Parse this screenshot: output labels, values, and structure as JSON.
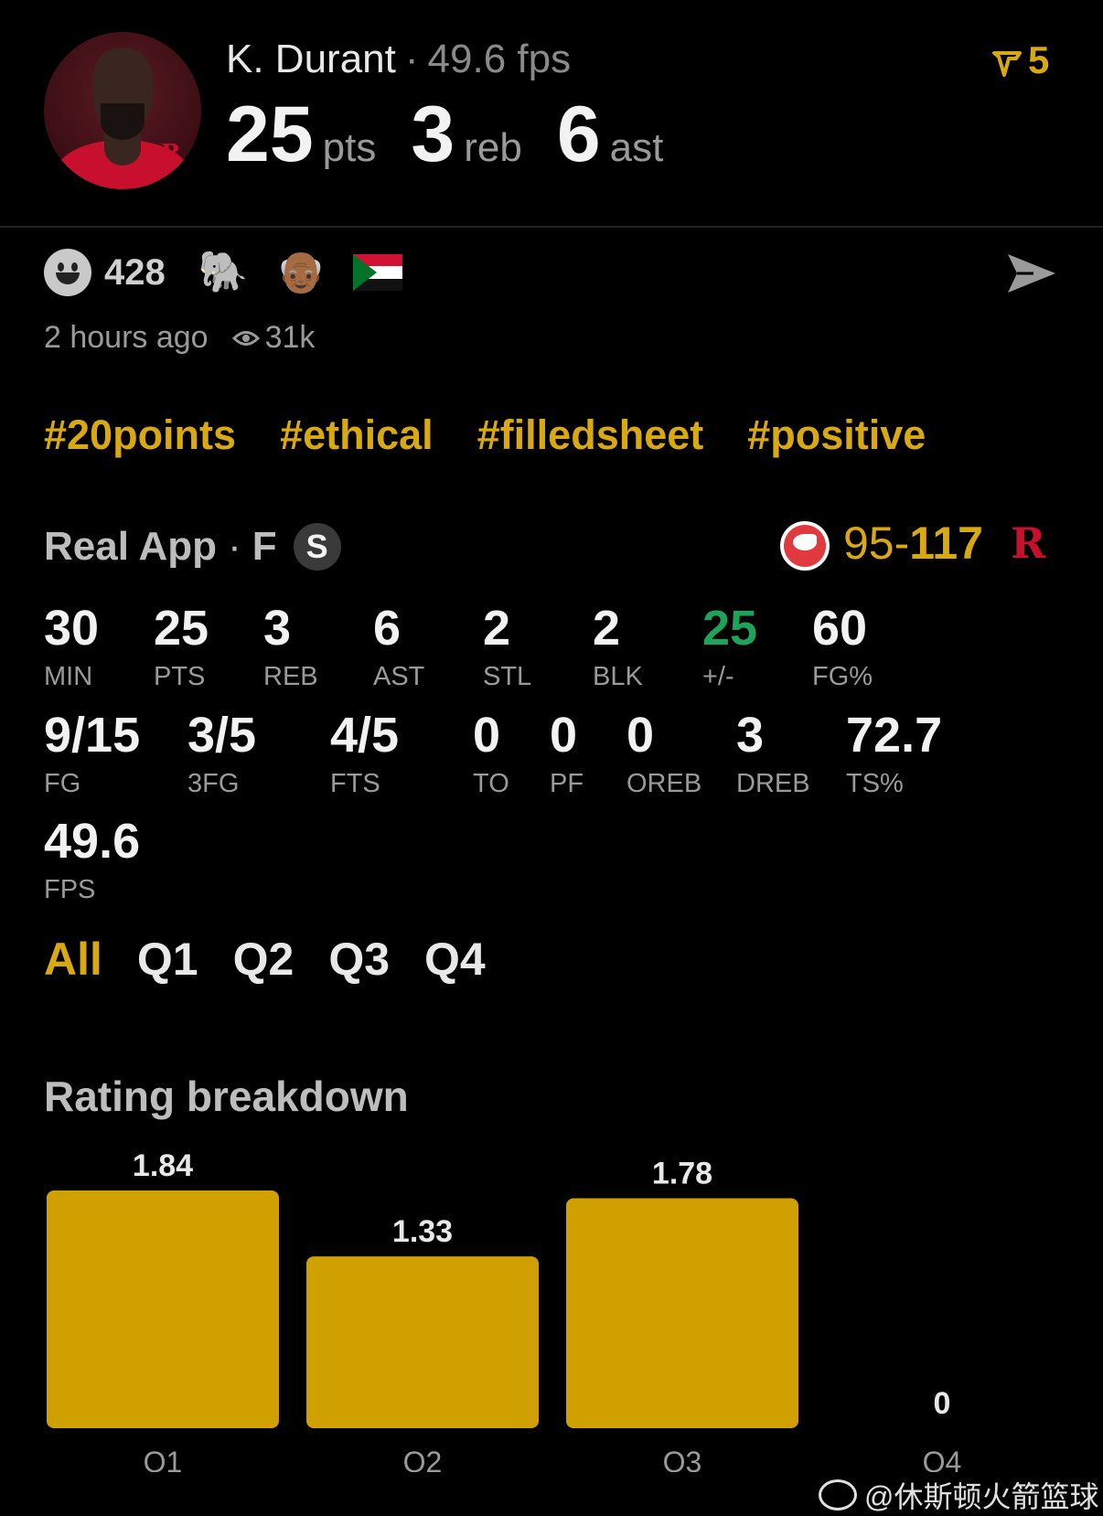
{
  "player": {
    "name": "K. Durant",
    "fps_label": "49.6 fps",
    "pts": "25",
    "pts_unit": "pts",
    "reb": "3",
    "reb_unit": "reb",
    "ast": "6",
    "ast_unit": "ast",
    "team_logo": "R"
  },
  "streak": {
    "icon": "vote-arrow-icon",
    "count": "5",
    "color": "#d9a912"
  },
  "reactions": {
    "count": "428",
    "emojis": [
      "🐘",
      "👴🏾"
    ],
    "flag": "sudan-flag"
  },
  "meta": {
    "time": "2 hours ago",
    "views": "31k"
  },
  "tags": [
    "#20points",
    "#ethical",
    "#filledsheet",
    "#positive"
  ],
  "game": {
    "source": "Real App",
    "position": "F",
    "badge": "S",
    "score_opp": "95-",
    "score_team": "117",
    "team_logo": "R"
  },
  "stats_row1": [
    {
      "value": "30",
      "label": "MIN"
    },
    {
      "value": "25",
      "label": "PTS"
    },
    {
      "value": "3",
      "label": "REB"
    },
    {
      "value": "6",
      "label": "AST"
    },
    {
      "value": "2",
      "label": "STL"
    },
    {
      "value": "2",
      "label": "BLK"
    },
    {
      "value": "25",
      "label": "+/-"
    },
    {
      "value": "60",
      "label": "FG%"
    }
  ],
  "stats_row2": [
    {
      "value": "9/15",
      "label": "FG"
    },
    {
      "value": "3/5",
      "label": "3FG"
    },
    {
      "value": "4/5",
      "label": "FTS"
    },
    {
      "value": "0",
      "label": "TO"
    },
    {
      "value": "0",
      "label": "PF"
    },
    {
      "value": "0",
      "label": "OREB"
    },
    {
      "value": "3",
      "label": "DREB"
    },
    {
      "value": "72.7",
      "label": "TS%"
    }
  ],
  "stats_row3": [
    {
      "value": "49.6",
      "label": "FPS"
    }
  ],
  "quarter_tabs": [
    "All",
    "Q1",
    "Q2",
    "Q3",
    "Q4"
  ],
  "chart_title": "Rating breakdown",
  "chart_data": {
    "type": "bar",
    "categories": [
      "Q1",
      "Q2",
      "Q3",
      "Q4"
    ],
    "values": [
      1.84,
      1.33,
      1.78,
      0
    ],
    "value_labels": [
      "1.84",
      "1.33",
      "1.78",
      "0"
    ],
    "color": "#d0a000",
    "title": "Rating breakdown"
  },
  "watermark": "@休斯顿火箭篮球"
}
